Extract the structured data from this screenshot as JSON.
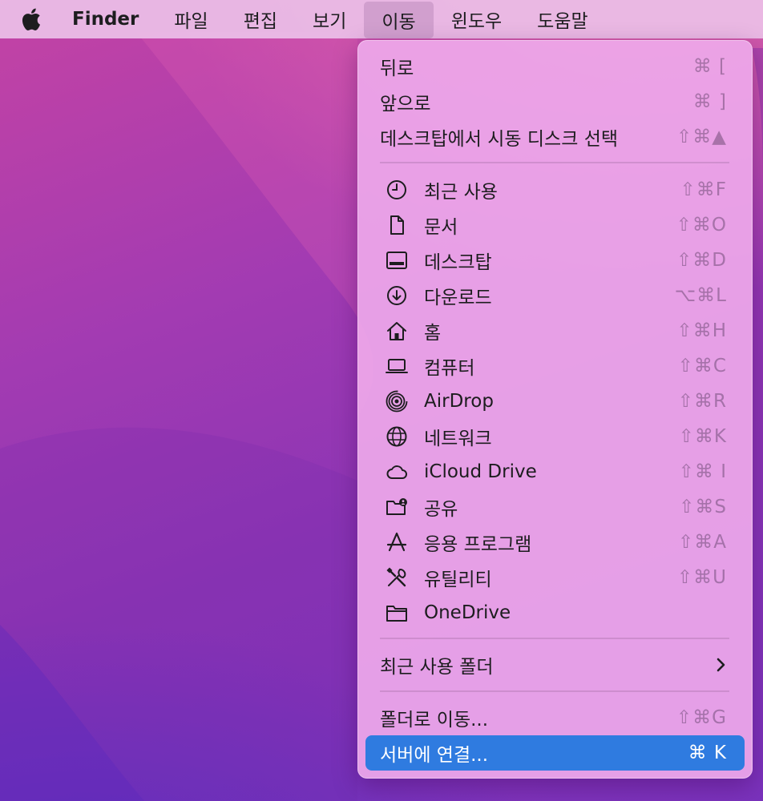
{
  "menubar": {
    "apple_icon": "apple-logo",
    "app_name": "Finder",
    "menus": [
      "파일",
      "편집",
      "보기",
      "이동",
      "윈도우",
      "도움말"
    ],
    "active_menu": "이동"
  },
  "go_menu": {
    "items": [
      {
        "label": "뒤로",
        "shortcut": "⌘ ["
      },
      {
        "label": "앞으로",
        "shortcut": "⌘ ]"
      },
      {
        "label": "데스크탑에서 시동 디스크 선택",
        "shortcut": "⇧⌘▲"
      },
      {
        "label": "최근 사용",
        "shortcut": "⇧⌘F",
        "icon": "clock-icon"
      },
      {
        "label": "문서",
        "shortcut": "⇧⌘O",
        "icon": "document-icon"
      },
      {
        "label": "데스크탑",
        "shortcut": "⇧⌘D",
        "icon": "desktop-icon"
      },
      {
        "label": "다운로드",
        "shortcut": "⌥⌘L",
        "icon": "download-icon"
      },
      {
        "label": "홈",
        "shortcut": "⇧⌘H",
        "icon": "home-icon"
      },
      {
        "label": "컴퓨터",
        "shortcut": "⇧⌘C",
        "icon": "laptop-icon"
      },
      {
        "label": "AirDrop",
        "shortcut": "⇧⌘R",
        "icon": "airdrop-icon"
      },
      {
        "label": "네트워크",
        "shortcut": "⇧⌘K",
        "icon": "globe-icon"
      },
      {
        "label": "iCloud Drive",
        "shortcut": "⇧⌘ I",
        "icon": "cloud-icon"
      },
      {
        "label": "공유",
        "shortcut": "⇧⌘S",
        "icon": "shared-folder-icon"
      },
      {
        "label": "응용 프로그램",
        "shortcut": "⇧⌘A",
        "icon": "applications-icon"
      },
      {
        "label": "유틸리티",
        "shortcut": "⇧⌘U",
        "icon": "utilities-icon"
      },
      {
        "label": "OneDrive",
        "shortcut": "",
        "icon": "folder-icon"
      },
      {
        "label": "최근 사용 폴더",
        "submenu_icon": "chevron-right-icon"
      },
      {
        "label": "폴더로 이동...",
        "shortcut": "⇧⌘G"
      },
      {
        "label": "서버에 연결...",
        "shortcut": "⌘ K",
        "selected": true
      }
    ]
  },
  "colors": {
    "selection": "#2f7be0",
    "menu_background": "#eea8ea",
    "menubar_background": "#ecc0e8"
  }
}
